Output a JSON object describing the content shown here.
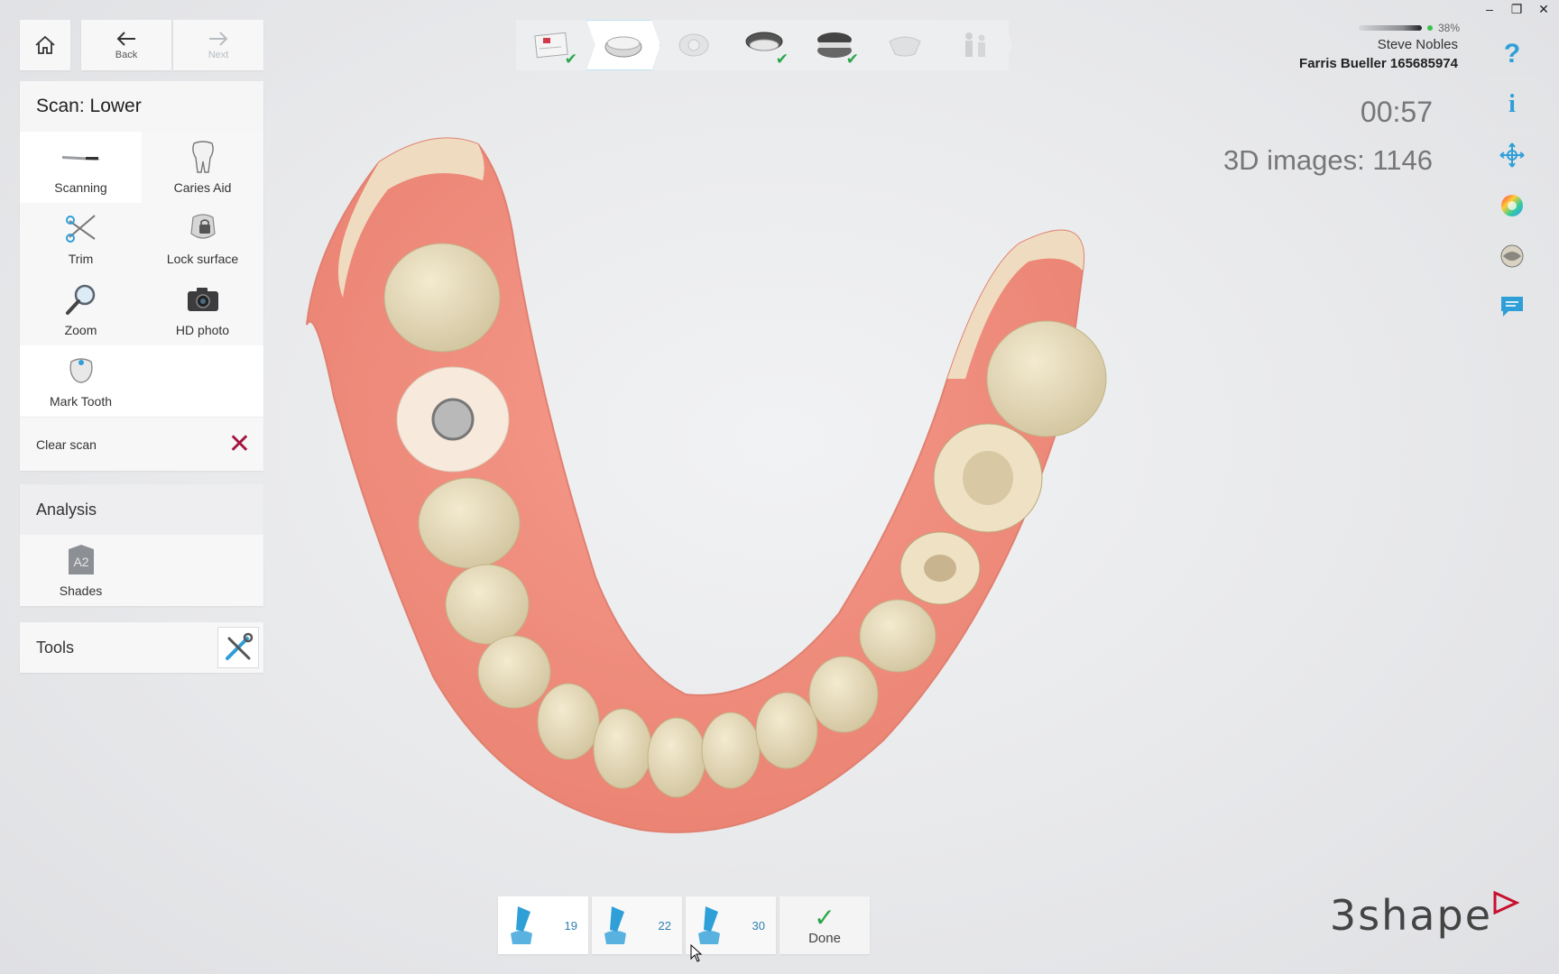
{
  "window": {
    "minimize": "–",
    "restore": "❐",
    "close": "✕"
  },
  "nav": {
    "back_label": "Back",
    "next_label": "Next"
  },
  "scan_panel": {
    "title": "Scan: Lower",
    "tools": [
      {
        "label": "Scanning",
        "icon": "scanner-wand-icon"
      },
      {
        "label": "Caries Aid",
        "icon": "tooth-icon"
      },
      {
        "label": "Trim",
        "icon": "scissors-icon"
      },
      {
        "label": "Lock surface",
        "icon": "lock-surface-icon"
      },
      {
        "label": "Zoom",
        "icon": "magnifier-icon"
      },
      {
        "label": "HD photo",
        "icon": "camera-icon"
      },
      {
        "label": "Mark Tooth",
        "icon": "mark-tooth-icon"
      }
    ],
    "clear_label": "Clear scan"
  },
  "analysis": {
    "title": "Analysis",
    "shade_badge": "A2",
    "shades_label": "Shades"
  },
  "tools": {
    "title": "Tools"
  },
  "scanner": {
    "battery": "38%"
  },
  "user": {
    "name": "Steve Nobles",
    "patient": "Farris Bueller 165685974"
  },
  "timer": "00:57",
  "image_count": "3D images: 1146",
  "scan_buttons": [
    {
      "count": "19"
    },
    {
      "count": "22"
    },
    {
      "count": "30"
    }
  ],
  "done_label": "Done",
  "brand": {
    "logo": "3shape",
    "accent": "#c8102e"
  },
  "colors": {
    "accent_blue": "#2f9fd8",
    "check_green": "#2aa64a",
    "clear_red": "#a3173f"
  }
}
